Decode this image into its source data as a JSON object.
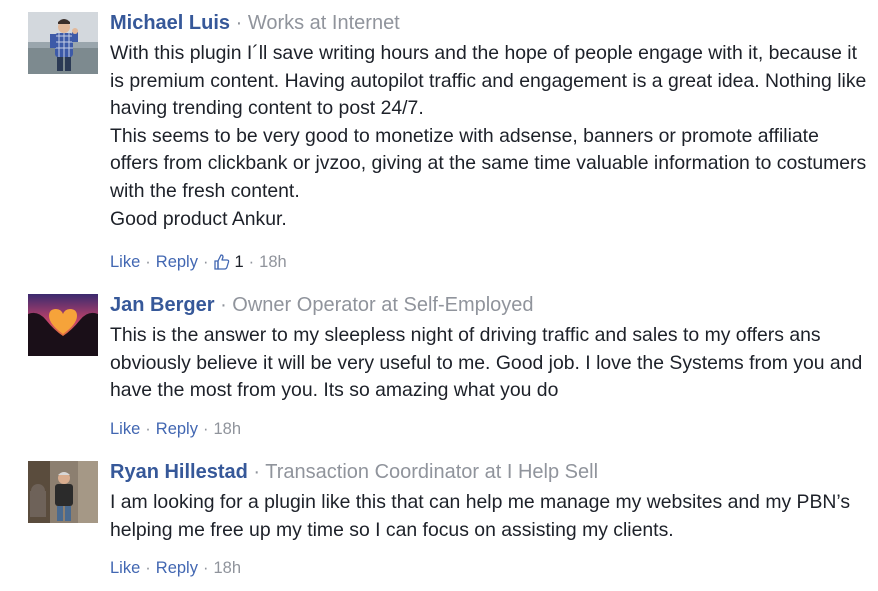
{
  "comments": [
    {
      "author": "Michael Luis",
      "role": "Works at Internet",
      "paragraphs": [
        "With this plugin I´ll save writing hours and the hope of people engage with it, because it is premium content. Having autopilot traffic and engagement is a great idea. Nothing like having trending content to post 24/7.",
        "This seems to be very good to monetize with adsense, banners or promote affiliate offers from clickbank or jvzoo, giving at the same time valuable information to costumers with the fresh content.",
        "Good product Ankur."
      ],
      "like_label": "Like",
      "reply_label": "Reply",
      "like_count": "1",
      "time": "18h"
    },
    {
      "author": "Jan Berger",
      "role": "Owner Operator at Self-Employed",
      "paragraphs": [
        "This is the answer to my sleepless night of driving traffic and sales to my offers ans obviously believe it will be very useful to me. Good job. I love the Systems from you and have the most from you. Its so amazing what you do"
      ],
      "like_label": "Like",
      "reply_label": "Reply",
      "time": "18h"
    },
    {
      "author": "Ryan Hillestad",
      "role": "Transaction Coordinator at I Help Sell",
      "paragraphs": [
        "I am looking for a plugin like this that can help me manage my websites and my PBN’s helping me free up my time so I can focus on assisting my clients."
      ],
      "like_label": "Like",
      "reply_label": "Reply",
      "time": "18h"
    }
  ],
  "separators": {
    "dot": "·"
  },
  "colors": {
    "author": "#365899",
    "link": "#4267b2",
    "meta": "#90949c",
    "text": "#1d2129"
  },
  "icons": {
    "like_count_icon": "thumbs-up-icon"
  }
}
